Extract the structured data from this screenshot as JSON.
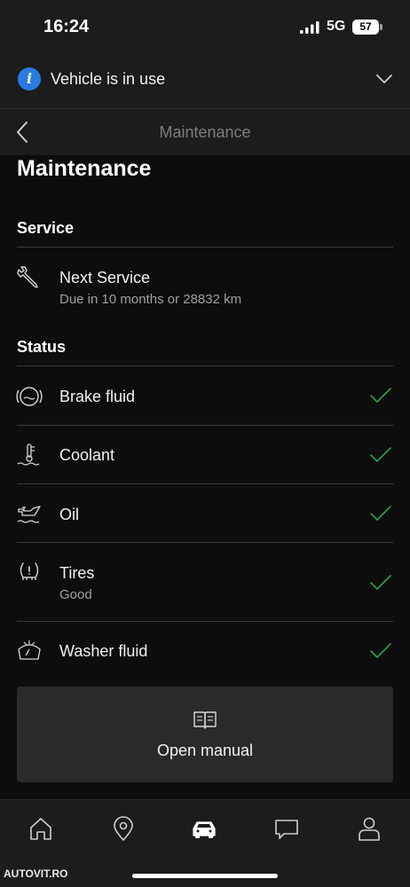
{
  "status_bar": {
    "time": "16:24",
    "network": "5G",
    "battery": "57"
  },
  "banner": {
    "text": "Vehicle is in use",
    "info_glyph": "i"
  },
  "nav": {
    "title": "Maintenance"
  },
  "page": {
    "title": "Maintenance"
  },
  "service": {
    "header": "Service",
    "next_service": {
      "title": "Next Service",
      "subtitle": "Due in 10 months or 28832 km",
      "icon": "wrench-icon"
    }
  },
  "status": {
    "header": "Status",
    "items": [
      {
        "title": "Brake fluid",
        "subtitle": "",
        "icon": "brake-fluid-icon",
        "ok": true
      },
      {
        "title": "Coolant",
        "subtitle": "",
        "icon": "coolant-icon",
        "ok": true
      },
      {
        "title": "Oil",
        "subtitle": "",
        "icon": "oil-can-icon",
        "ok": true
      },
      {
        "title": "Tires",
        "subtitle": "Good",
        "icon": "tire-pressure-icon",
        "ok": true
      },
      {
        "title": "Washer fluid",
        "subtitle": "",
        "icon": "washer-fluid-icon",
        "ok": true
      }
    ]
  },
  "manual": {
    "label": "Open manual",
    "icon": "book-icon"
  },
  "tabs": [
    "home-icon",
    "location-pin-icon",
    "car-icon",
    "chat-icon",
    "profile-icon"
  ],
  "watermark": "AUTOVIT.RO",
  "colors": {
    "check": "#2f9e4f",
    "accent": "#2a7ae2",
    "background": "#0d0d0d",
    "card": "#2a2a2a"
  }
}
